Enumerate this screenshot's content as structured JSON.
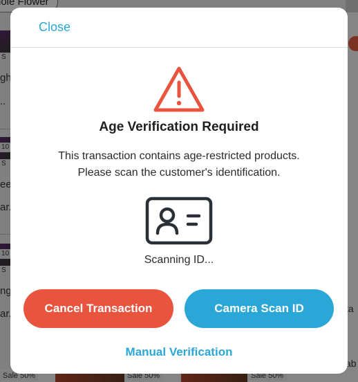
{
  "background": {
    "filter_pill": "hole Flower",
    "side_fragments": [
      "gh",
      "..",
      "ee",
      "ar.",
      "ng",
      "ar."
    ],
    "tags": [
      "S",
      "10",
      "S",
      "10",
      "S"
    ],
    "sale_labels": [
      "Sale 50%",
      "Sale 50%",
      "Sale 50%"
    ],
    "right_fragments": [
      "ta",
      "ab"
    ]
  },
  "modal": {
    "close_label": "Close",
    "title": "Age Verification Required",
    "message_line1": "This transaction contains age-restricted products.",
    "message_line2": "Please scan the customer's identification.",
    "scanning_status": "Scanning ID...",
    "cancel_button": "Cancel Transaction",
    "camera_button": "Camera Scan ID",
    "manual_link": "Manual Verification"
  },
  "icons": {
    "warning": "warning-triangle-icon",
    "id": "id-card-icon"
  },
  "colors": {
    "accent_blue": "#2aa7d6",
    "cancel_red": "#e8543e",
    "camera_blue": "#2aa7d6",
    "warning_red": "#e8543e",
    "icon_dark": "#2b2f36"
  }
}
